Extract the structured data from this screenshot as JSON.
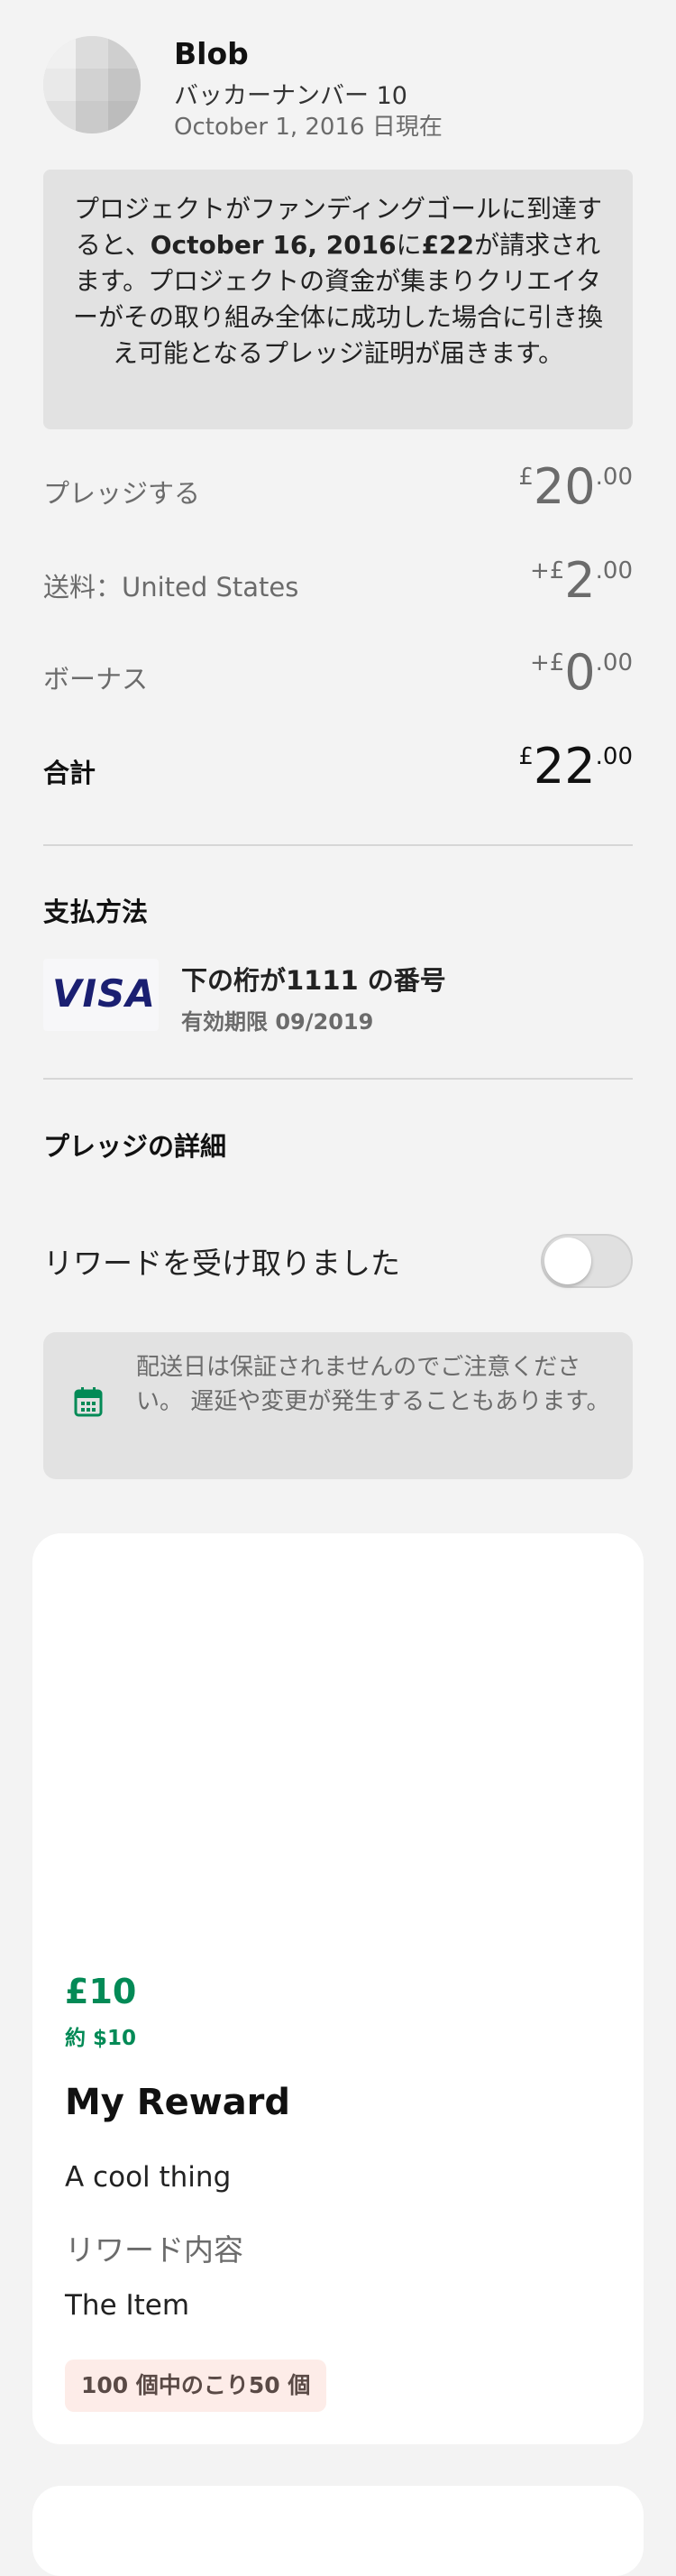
{
  "backer": {
    "name": "Blob",
    "number": "バッカーナンバー 10",
    "as_of": "October 1, 2016 日現在"
  },
  "notice": {
    "part1": "プロジェクトがファンディングゴールに到達すると、",
    "date": "October 16, 2016",
    "part2": "に",
    "amount": "£22",
    "part3": "が請求されます。プロジェクトの資金が集まりクリエイターがその取り組み全体に成功した場合に引き換え可能となるプレッジ証明が届きます。"
  },
  "summary": {
    "pledge": {
      "label": "プレッジする",
      "prefix": "",
      "currency": "£",
      "whole": "20",
      "decimal": ".00"
    },
    "shipping": {
      "label": "送料：United States",
      "prefix": "+",
      "currency": "£",
      "whole": "2",
      "decimal": ".00"
    },
    "bonus": {
      "label": "ボーナス",
      "prefix": "+",
      "currency": "£",
      "whole": "0",
      "decimal": ".00"
    },
    "total": {
      "label": "合計",
      "prefix": "",
      "currency": "£",
      "whole": "22",
      "decimal": ".00"
    }
  },
  "payment": {
    "title": "支払方法",
    "brand": "VISA",
    "number_text": "下の桁が1111 の番号",
    "expiry": "有効期限 09/2019"
  },
  "pledge_details": {
    "title": "プレッジの詳細",
    "reward_received_label": "リワードを受け取りました",
    "reward_received": false
  },
  "delivery_notice": {
    "icon": "calendar-icon",
    "text": "配送日は保証されませんのでご注意ください。 遅延や変更が発生することもあります。"
  },
  "reward": {
    "price": "£10",
    "approx": "約 $10",
    "title": "My Reward",
    "description": "A cool thing",
    "includes_label": "リワード内容",
    "item": "The Item",
    "remaining": "100 個中のこり50 個"
  },
  "colors": {
    "accent_green": "#038a56",
    "background": "#f3f3f3",
    "visa_blue": "#1a1f71"
  }
}
